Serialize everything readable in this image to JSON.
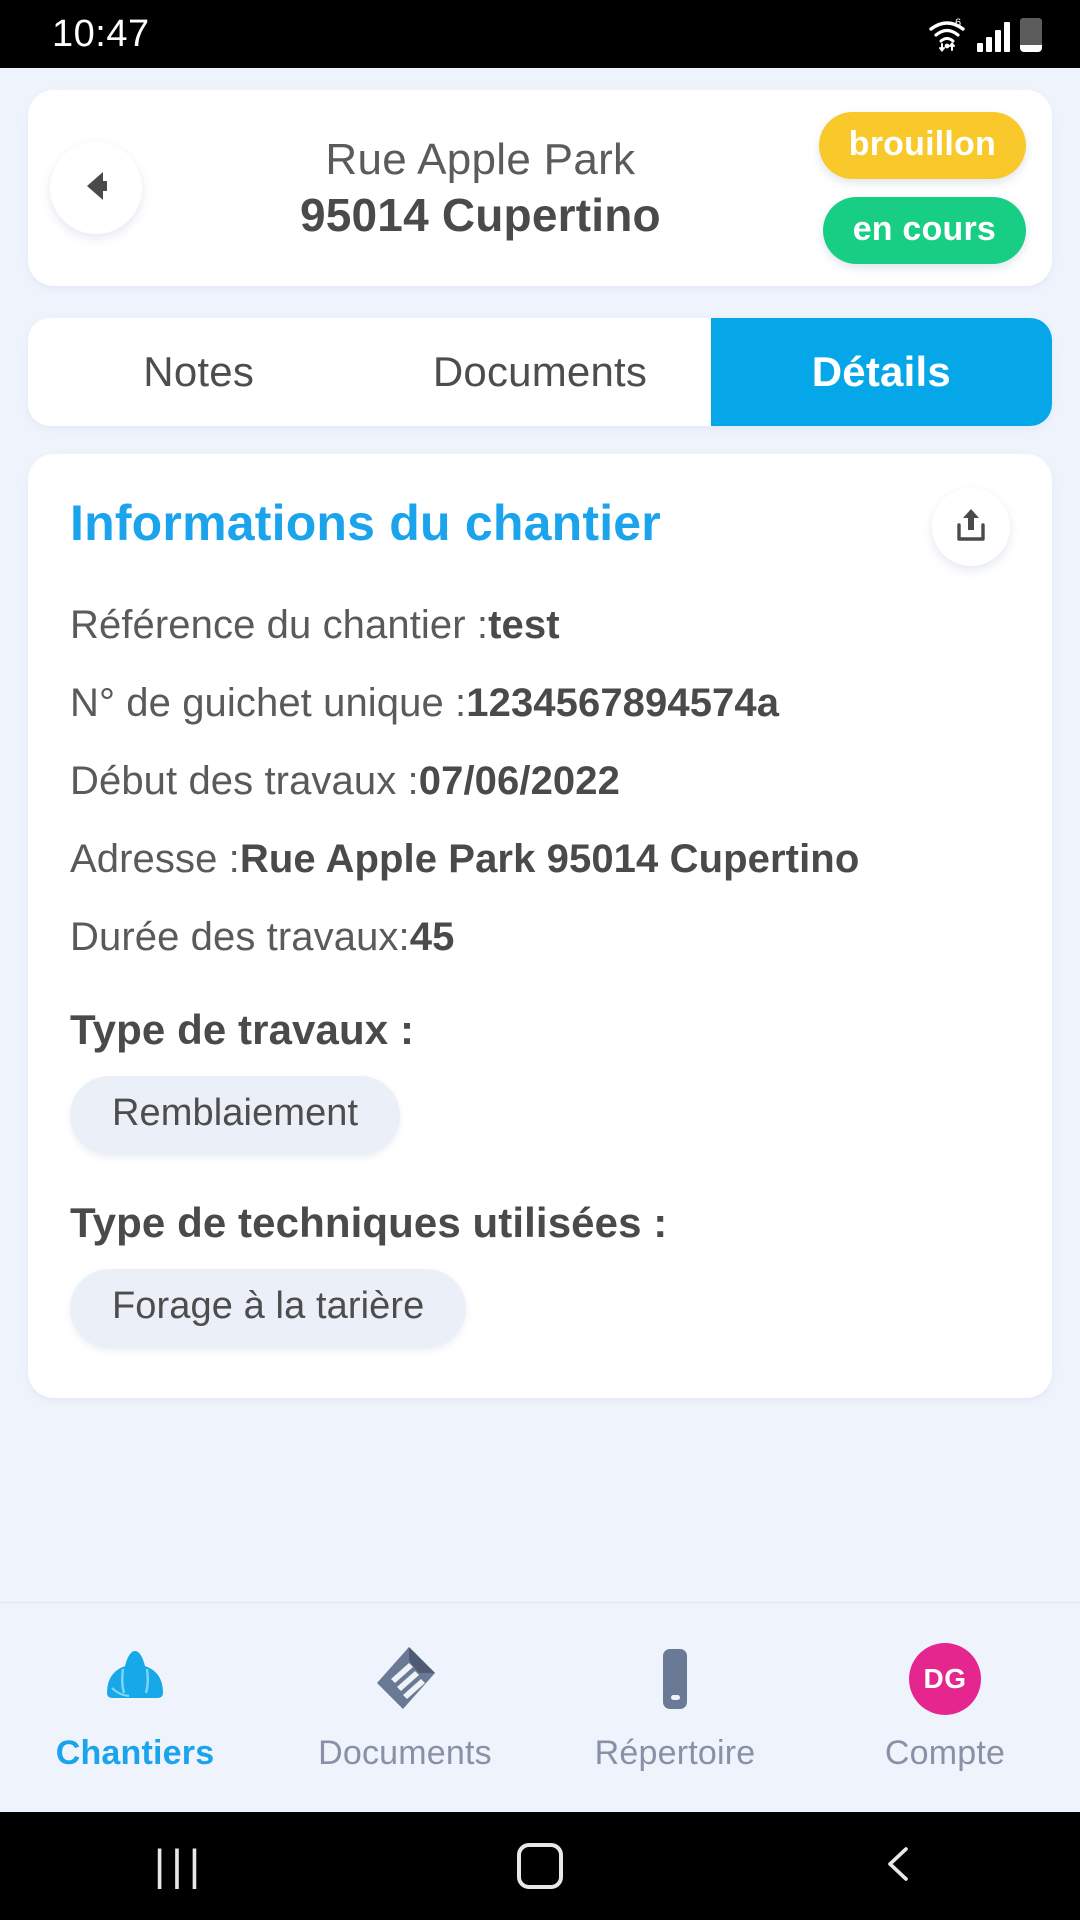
{
  "status_bar": {
    "time": "10:47",
    "wifi_icon": "wifi-6-icon",
    "signal_icon": "cellular-signal-icon",
    "battery_icon": "battery-icon"
  },
  "header": {
    "back_icon": "back-arrow-icon",
    "address_line1": "Rue Apple Park",
    "address_line2": "95014 Cupertino",
    "badges": [
      {
        "label": "brouillon",
        "color": "#F9C92C"
      },
      {
        "label": "en cours",
        "color": "#18CE84"
      }
    ]
  },
  "tabs": [
    {
      "label": "Notes",
      "active": false
    },
    {
      "label": "Documents",
      "active": false
    },
    {
      "label": "Détails",
      "active": true
    }
  ],
  "details_card": {
    "title": "Informations du chantier",
    "share_icon": "share-icon",
    "fields": [
      {
        "label": "Référence du chantier :",
        "value": "test"
      },
      {
        "label": "N° de guichet unique :",
        "value": "1234567894574a"
      },
      {
        "label": "Début des travaux :",
        "value": "07/06/2022"
      },
      {
        "label": "Adresse :",
        "value": "Rue Apple Park 95014 Cupertino"
      },
      {
        "label": "Durée des travaux:",
        "value": "45"
      }
    ],
    "work_type": {
      "title": "Type de travaux :",
      "chips": [
        "Remblaiement"
      ]
    },
    "technique_type": {
      "title": "Type de techniques utilisées :",
      "chips": [
        "Forage à la tarière"
      ]
    }
  },
  "bottom_nav": [
    {
      "label": "Chantiers",
      "icon": "hard-hat-icon",
      "active": true
    },
    {
      "label": "Documents",
      "icon": "documents-icon",
      "active": false
    },
    {
      "label": "Répertoire",
      "icon": "phone-icon",
      "active": false
    },
    {
      "label": "Compte",
      "icon": "avatar-icon",
      "avatar_initials": "DG",
      "active": false
    }
  ],
  "system_nav": {
    "recent_icon": "recent-apps-icon",
    "home_icon": "home-icon",
    "back_icon": "system-back-icon"
  },
  "colors": {
    "accent_blue": "#1BA4EB",
    "tab_blue": "#06A7E8",
    "draft_yellow": "#F9C92C",
    "progress_green": "#18CE84",
    "avatar_pink": "#E5268F",
    "page_bg": "#EFF3FC",
    "chip_bg": "#EBEFF8"
  }
}
